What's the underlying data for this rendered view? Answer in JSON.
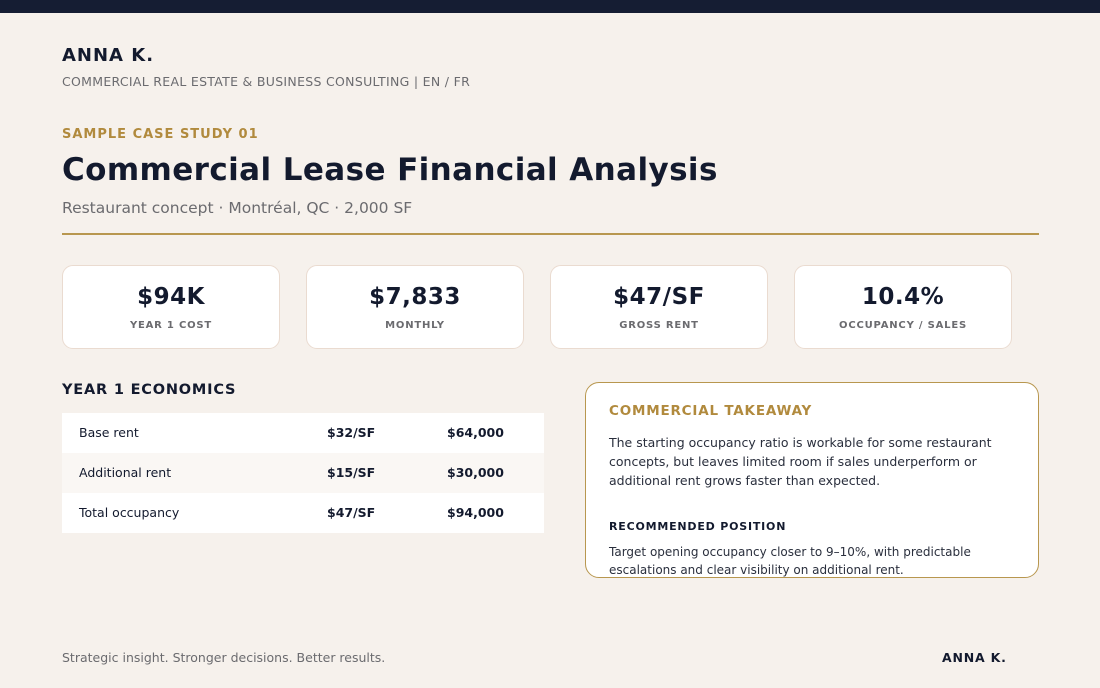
{
  "header": {
    "brand": "ANNA K.",
    "tagline": "COMMERCIAL REAL ESTATE & BUSINESS CONSULTING  |  EN / FR"
  },
  "hero": {
    "eyebrow": "SAMPLE CASE STUDY 01",
    "title": "Commercial Lease Financial Analysis",
    "subtitle": "Restaurant concept · Montréal, QC · 2,000 SF"
  },
  "kpis": [
    {
      "value": "$94K",
      "label": "YEAR 1 COST"
    },
    {
      "value": "$7,833",
      "label": "MONTHLY"
    },
    {
      "value": "$47/SF",
      "label": "GROSS RENT"
    },
    {
      "value": "10.4%",
      "label": "OCCUPANCY / SALES"
    }
  ],
  "economics": {
    "title": "YEAR 1 ECONOMICS",
    "rows": [
      {
        "item": "Base rent",
        "rate": "$32/SF",
        "amount": "$64,000"
      },
      {
        "item": "Additional rent",
        "rate": "$15/SF",
        "amount": "$30,000"
      },
      {
        "item": "Total occupancy",
        "rate": "$47/SF",
        "amount": "$94,000"
      }
    ]
  },
  "takeaway": {
    "title": "COMMERCIAL TAKEAWAY",
    "body": "The starting occupancy ratio is workable for some restaurant concepts, but leaves limited room if sales underperform or additional rent grows faster than expected.",
    "position_title": "RECOMMENDED POSITION",
    "position_body": "Target opening occupancy closer to 9–10%, with predictable escalations and clear visibility on additional rent."
  },
  "footer": {
    "slogan": "Strategic insight. Stronger decisions. Better results.",
    "brand": "ANNA K."
  },
  "colors": {
    "navy": "#151d33",
    "gold": "#b18a3d",
    "background": "#f6f1ec"
  }
}
